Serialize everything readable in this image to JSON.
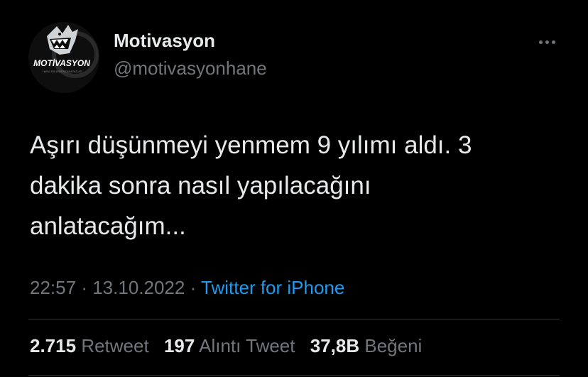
{
  "colors": {
    "background": "#000000",
    "text_primary": "#e7e9ea",
    "text_secondary": "#71767b",
    "link": "#1d9bf0",
    "divider": "#2f3336"
  },
  "author": {
    "display_name": "Motivasyon",
    "handle": "@motivasyonhane",
    "avatar": {
      "icon": "shark-logo-icon",
      "logo_text": "MOTİVASYON",
      "logo_subtext": "HAYAL EDİLENDEN DAHA FAZLASI"
    }
  },
  "more_icon": "more-horizontal-icon",
  "tweet": {
    "text_lines": [
      "Aşırı düşünmeyi yenmem 9 yılımı aldı. 3",
      "dakika sonra nasıl yapılacağını",
      "anlatacağım..."
    ],
    "time": "22:57",
    "separator": "·",
    "date": "13.10.2022",
    "source": "Twitter for iPhone"
  },
  "stats": {
    "retweets": {
      "count": "2.715",
      "label": "Retweet"
    },
    "quotes": {
      "count": "197",
      "label": "Alıntı Tweet"
    },
    "likes": {
      "count": "37,8B",
      "label": "Beğeni"
    }
  }
}
